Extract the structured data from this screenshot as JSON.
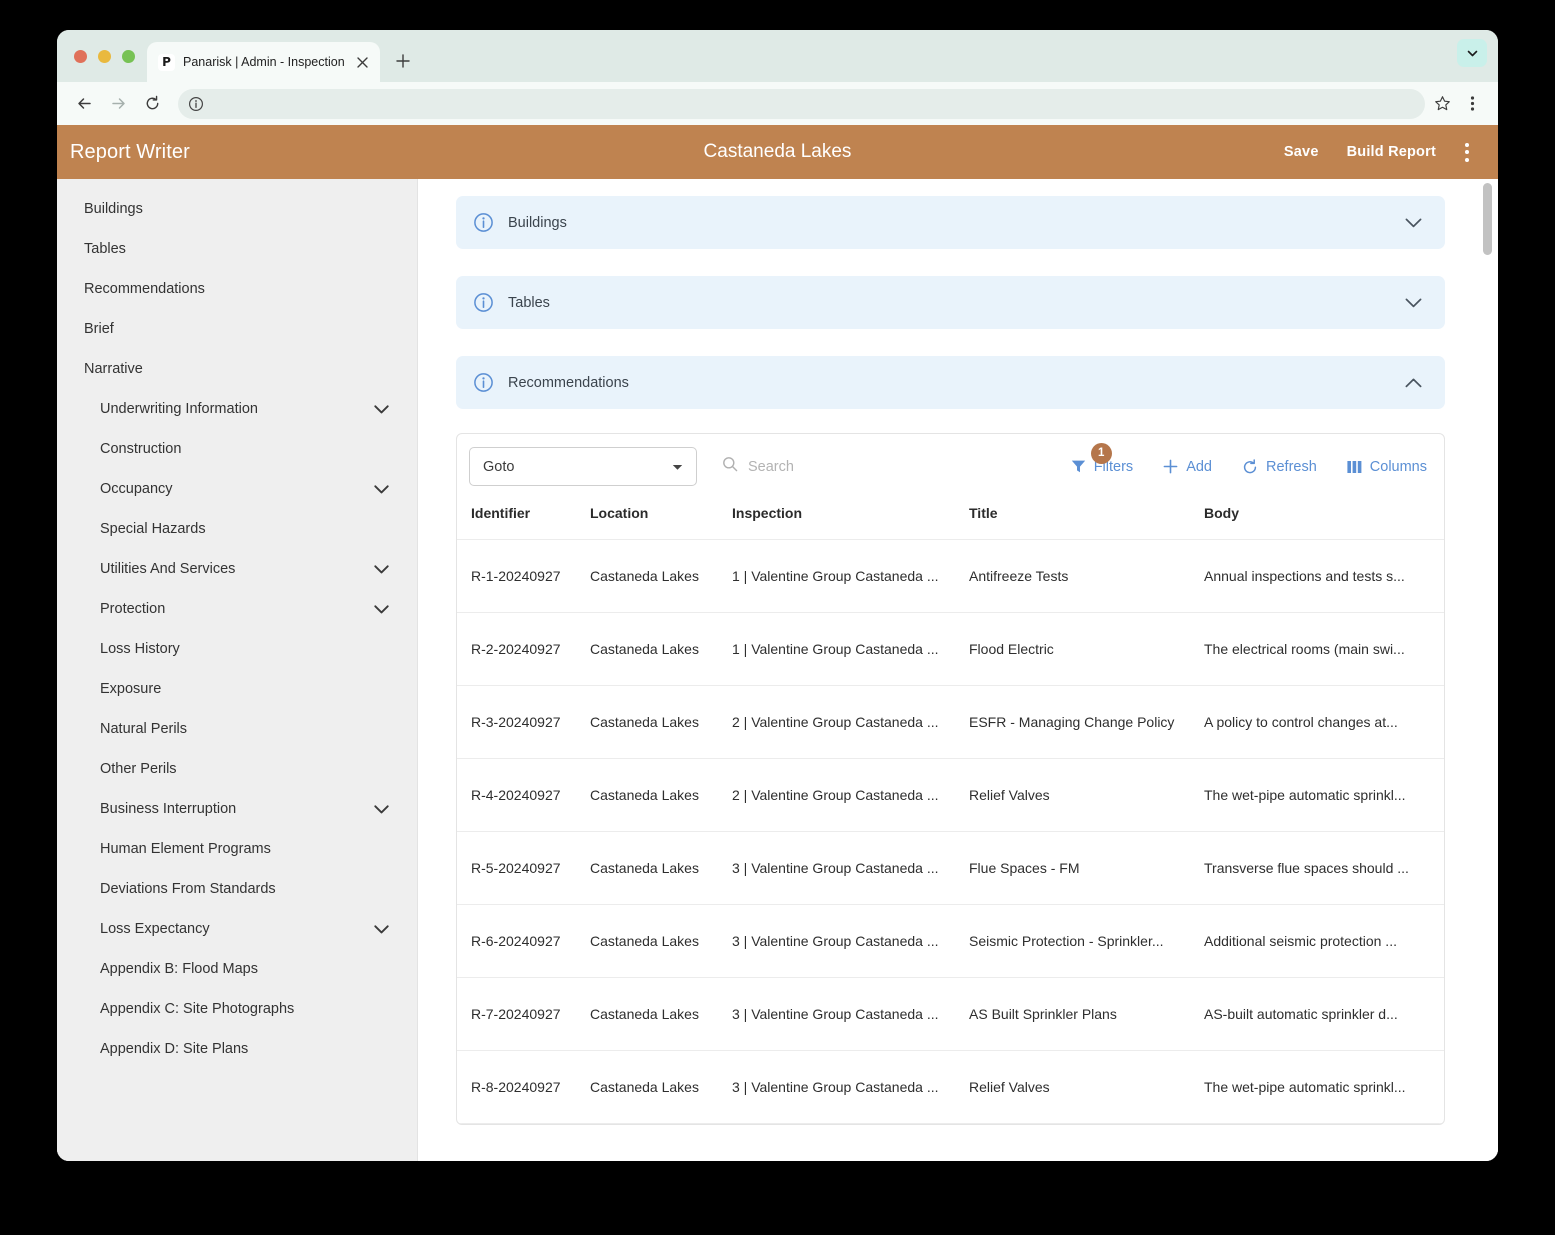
{
  "browser": {
    "tab": {
      "favicon": "panarisk-p-logo-icon",
      "favicon_letter": "P",
      "title": "Panarisk | Admin - Inspection",
      "close_icon": "close-icon"
    },
    "new_tab_icon": "plus-icon",
    "tabstrip_overflow_icon": "chevron-down-icon",
    "toolbar": {
      "back_icon": "back-arrow-icon",
      "forward_icon": "forward-arrow-icon",
      "reload_icon": "reload-icon",
      "site_info_icon": "info-circle-icon",
      "url": "",
      "url_placeholder": "",
      "bookmark_icon": "star-icon",
      "menu_icon": "kebab-menu-icon"
    }
  },
  "app": {
    "name": "Report Writer",
    "title": "Castaneda Lakes",
    "actions": {
      "save_label": "Save",
      "build_report_label": "Build Report",
      "overflow_icon": "kebab-menu-icon"
    },
    "header_color": "#bf8350"
  },
  "sidebar": {
    "items": [
      {
        "label": "Buildings",
        "level": 0,
        "expandable": false
      },
      {
        "label": "Tables",
        "level": 0,
        "expandable": false
      },
      {
        "label": "Recommendations",
        "level": 0,
        "expandable": false
      },
      {
        "label": "Brief",
        "level": 0,
        "expandable": false
      },
      {
        "label": "Narrative",
        "level": 0,
        "expandable": false
      },
      {
        "label": "Underwriting Information",
        "level": 1,
        "expandable": true
      },
      {
        "label": "Construction",
        "level": 1,
        "expandable": false
      },
      {
        "label": "Occupancy",
        "level": 1,
        "expandable": true
      },
      {
        "label": "Special Hazards",
        "level": 1,
        "expandable": false
      },
      {
        "label": "Utilities And Services",
        "level": 1,
        "expandable": true
      },
      {
        "label": "Protection",
        "level": 1,
        "expandable": true
      },
      {
        "label": "Loss History",
        "level": 1,
        "expandable": false
      },
      {
        "label": "Exposure",
        "level": 1,
        "expandable": false
      },
      {
        "label": "Natural Perils",
        "level": 1,
        "expandable": false
      },
      {
        "label": "Other Perils",
        "level": 1,
        "expandable": false
      },
      {
        "label": "Business Interruption",
        "level": 1,
        "expandable": true
      },
      {
        "label": "Human Element Programs",
        "level": 1,
        "expandable": false
      },
      {
        "label": "Deviations From Standards",
        "level": 1,
        "expandable": false
      },
      {
        "label": "Loss Expectancy",
        "level": 1,
        "expandable": true
      },
      {
        "label": "Appendix B: Flood Maps",
        "level": 1,
        "expandable": false
      },
      {
        "label": "Appendix C: Site Photographs",
        "level": 1,
        "expandable": false
      },
      {
        "label": "Appendix D: Site Plans",
        "level": 1,
        "expandable": false
      }
    ]
  },
  "accordions": [
    {
      "label": "Buildings",
      "expanded": false,
      "icon": "info-circle-icon",
      "chevron": "chevron-down-icon"
    },
    {
      "label": "Tables",
      "expanded": false,
      "icon": "info-circle-icon",
      "chevron": "chevron-down-icon"
    },
    {
      "label": "Recommendations",
      "expanded": true,
      "icon": "info-circle-icon",
      "chevron": "chevron-up-icon"
    }
  ],
  "grid": {
    "goto": {
      "value": "Goto",
      "chevron_icon": "chevron-down-icon"
    },
    "search": {
      "value": "",
      "placeholder": "Search",
      "icon": "search-icon"
    },
    "actions": [
      {
        "label": "Filters",
        "icon": "filter-icon",
        "badge": "1"
      },
      {
        "label": "Add",
        "icon": "plus-icon",
        "badge": ""
      },
      {
        "label": "Refresh",
        "icon": "refresh-icon",
        "badge": ""
      },
      {
        "label": "Columns",
        "icon": "columns-icon",
        "badge": ""
      }
    ],
    "columns": [
      "Identifier",
      "Location",
      "Inspection",
      "Title",
      "Body"
    ],
    "rows": [
      {
        "identifier": "R-1-20240927",
        "location": "Castaneda Lakes",
        "inspection": "1 | Valentine Group Castaneda ...",
        "title": "Antifreeze Tests",
        "body": "Annual inspections and tests s..."
      },
      {
        "identifier": "R-2-20240927",
        "location": "Castaneda Lakes",
        "inspection": "1 | Valentine Group Castaneda ...",
        "title": "Flood Electric",
        "body": "The electrical rooms (main swi..."
      },
      {
        "identifier": "R-3-20240927",
        "location": "Castaneda Lakes",
        "inspection": "2 | Valentine Group Castaneda ...",
        "title": "ESFR - Managing Change Policy",
        "body": "A policy to control changes at..."
      },
      {
        "identifier": "R-4-20240927",
        "location": "Castaneda Lakes",
        "inspection": "2 | Valentine Group Castaneda ...",
        "title": "Relief Valves",
        "body": "The wet-pipe automatic sprinkl..."
      },
      {
        "identifier": "R-5-20240927",
        "location": "Castaneda Lakes",
        "inspection": "3 | Valentine Group Castaneda ...",
        "title": "Flue Spaces - FM",
        "body": "Transverse flue spaces should ..."
      },
      {
        "identifier": "R-6-20240927",
        "location": "Castaneda Lakes",
        "inspection": "3 | Valentine Group Castaneda ...",
        "title": "Seismic Protection - Sprinkler...",
        "body": "Additional seismic protection ..."
      },
      {
        "identifier": "R-7-20240927",
        "location": "Castaneda Lakes",
        "inspection": "3 | Valentine Group Castaneda ...",
        "title": "AS Built Sprinkler Plans",
        "body": "AS-built automatic sprinkler d..."
      },
      {
        "identifier": "R-8-20240927",
        "location": "Castaneda Lakes",
        "inspection": "3 | Valentine Group Castaneda ...",
        "title": "Relief Valves",
        "body": "The wet-pipe automatic sprinkl..."
      }
    ]
  }
}
